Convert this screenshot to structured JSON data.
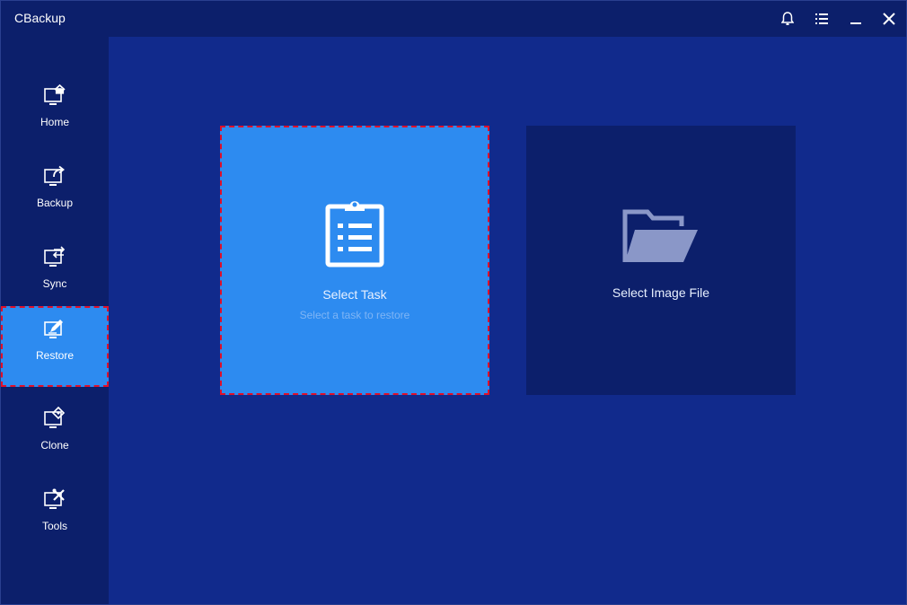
{
  "app": {
    "title": "CBackup"
  },
  "titlebar": {
    "icons": [
      "bell-icon",
      "menu-icon",
      "minimize-icon",
      "close-icon"
    ]
  },
  "sidebar": {
    "items": [
      {
        "label": "Home",
        "icon": "home-icon",
        "active": false
      },
      {
        "label": "Backup",
        "icon": "backup-icon",
        "active": false
      },
      {
        "label": "Sync",
        "icon": "sync-icon",
        "active": false
      },
      {
        "label": "Restore",
        "icon": "restore-icon",
        "active": true
      },
      {
        "label": "Clone",
        "icon": "clone-icon",
        "active": false
      },
      {
        "label": "Tools",
        "icon": "tools-icon",
        "active": false
      }
    ]
  },
  "main": {
    "cards": [
      {
        "title": "Select Task",
        "subtitle": "Select a task to restore",
        "icon": "clipboard-list-icon",
        "selected": true
      },
      {
        "title": "Select Image File",
        "icon": "folder-open-icon",
        "selected": false
      }
    ]
  },
  "colors": {
    "sidebar_bg": "#0c1f6b",
    "main_bg": "#112a8c",
    "accent": "#2d8bf0",
    "highlight_border": "#e0102a"
  }
}
